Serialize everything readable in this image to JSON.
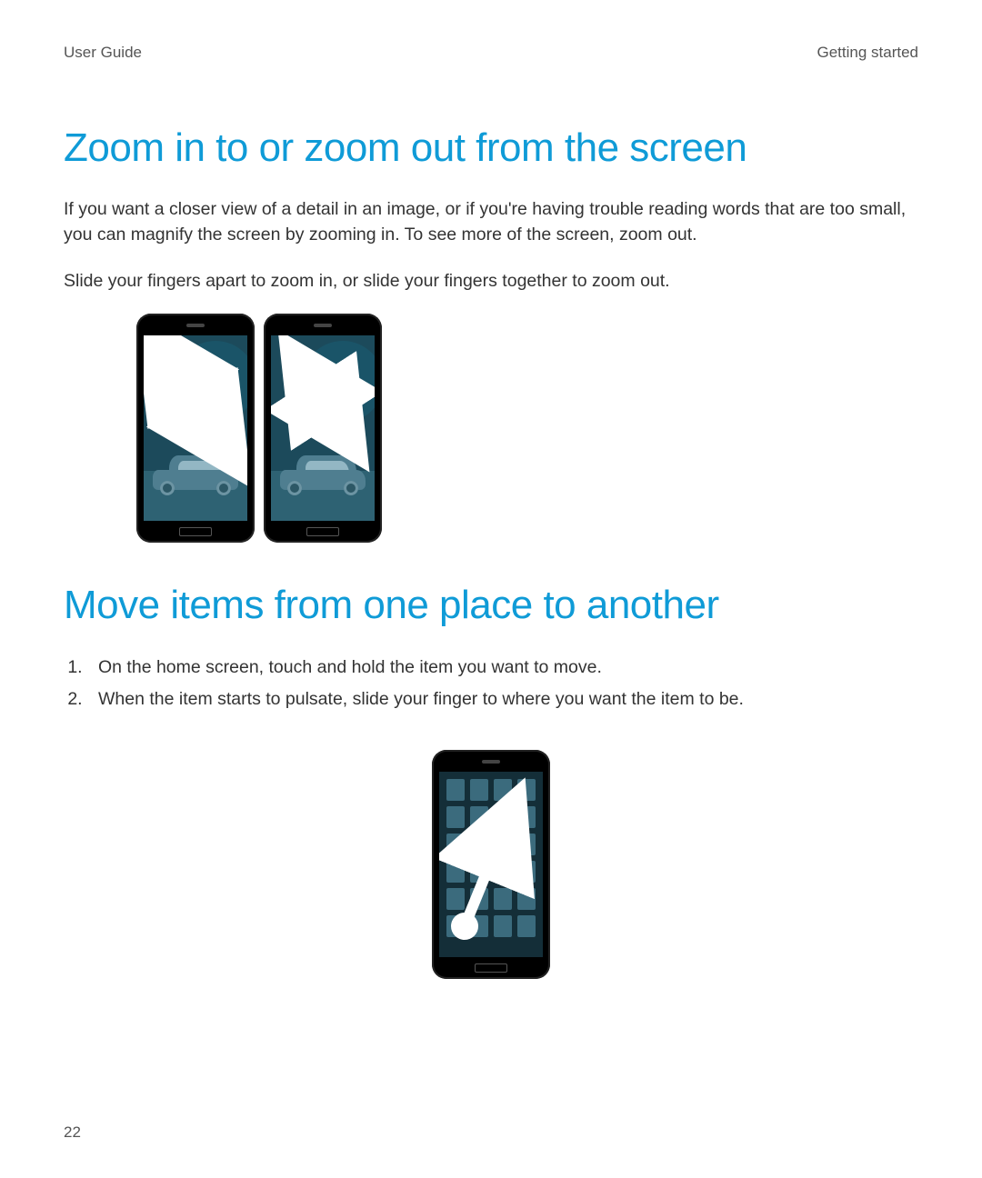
{
  "header": {
    "doc_title": "User Guide",
    "chapter": "Getting started"
  },
  "sections": [
    {
      "title": "Zoom in to or zoom out from the screen",
      "paragraphs": [
        "If you want a closer view of a detail in an image, or if you're having trouble reading words that are too small, you can magnify the screen by zooming in. To see more of the screen, zoom out.",
        "Slide your fingers apart to zoom in, or slide your fingers together to zoom out."
      ]
    },
    {
      "title": "Move items from one place to another",
      "steps": [
        "On the home screen, touch and hold the item you want to move.",
        "When the item starts to pulsate, slide your finger to where you want the item to be."
      ]
    }
  ],
  "page_number": "22",
  "illustrations": {
    "zoom": [
      {
        "name": "pinch-out-phone",
        "gesture": "zoom-in"
      },
      {
        "name": "pinch-in-phone",
        "gesture": "zoom-out"
      }
    ],
    "move": {
      "name": "drag-item-phone",
      "gesture": "drag"
    }
  },
  "colors": {
    "accent": "#0f9bd7",
    "screen_bg": "#1c4a5b"
  }
}
